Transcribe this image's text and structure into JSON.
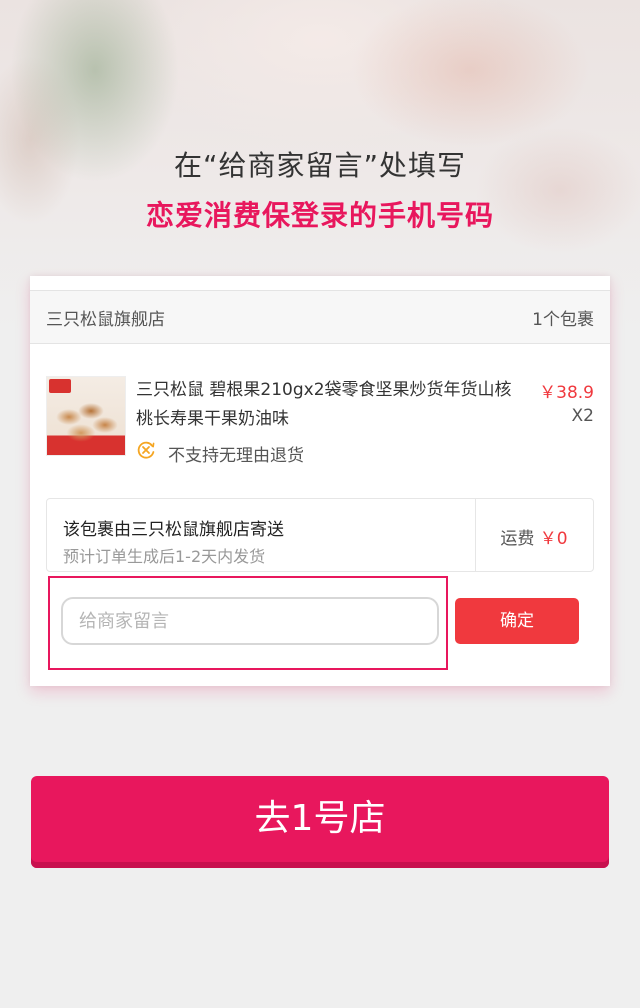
{
  "headline": {
    "line1": "在“给商家留言”处填写",
    "line2": "恋爱消费保登录的手机号码"
  },
  "order": {
    "shop_name": "三只松鼠旗舰店",
    "package_count": "1个包裹",
    "product": {
      "title": "三只松鼠 碧根果210gx2袋零食坚果炒货年货山核桃长寿果干果奶油味",
      "price": "￥38.9",
      "quantity": "X2",
      "return_policy": "不支持无理由退货",
      "return_policy_icon": "no-return-icon"
    },
    "shipping": {
      "shipped_by": "该包裹由三只松鼠旗舰店寄送",
      "estimate": "预计订单生成后1-2天内发货",
      "fee_label": "运费",
      "fee_value": "￥0"
    },
    "message": {
      "value": "",
      "placeholder": "给商家留言"
    },
    "confirm_label": "确定"
  },
  "go_store_label": "去1号店",
  "colors": {
    "accent_pink": "#e8175d",
    "price_red": "#f0393e",
    "warning_orange": "#f5a623"
  }
}
